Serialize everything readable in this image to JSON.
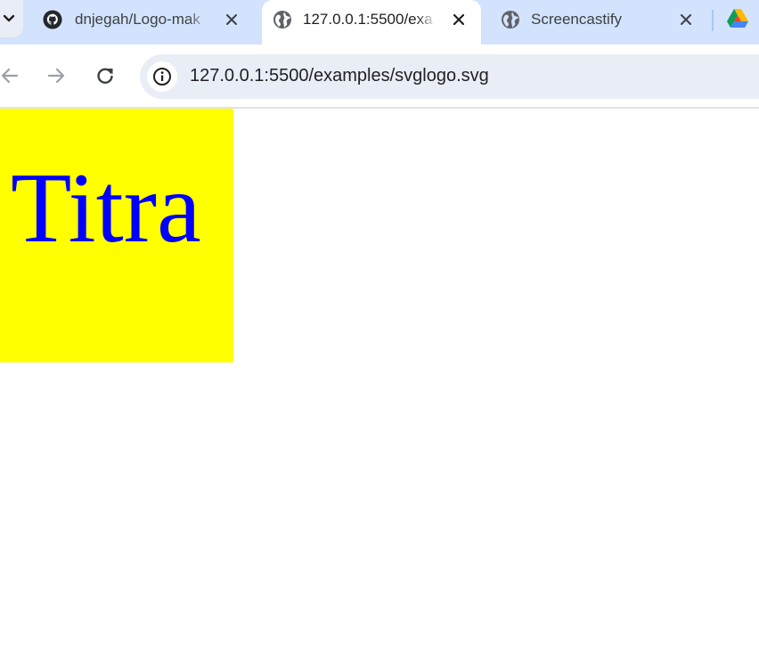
{
  "browser": {
    "tabs": [
      {
        "title": "dnjegah/Logo-mak",
        "favicon": "github-icon",
        "active": false
      },
      {
        "title": "127.0.0.1:5500/exa",
        "favicon": "globe-icon",
        "active": true
      },
      {
        "title": "Screencastify",
        "favicon": "globe-icon",
        "active": false
      }
    ],
    "url": "127.0.0.1:5500/examples/svglogo.svg"
  },
  "page": {
    "logo_text": "Titra"
  },
  "colors": {
    "tabstrip_bg": "#d3e3fd",
    "omnibox_bg": "#e9eef6",
    "logo_background": "#ffff00",
    "logo_text": "#0000ff"
  }
}
